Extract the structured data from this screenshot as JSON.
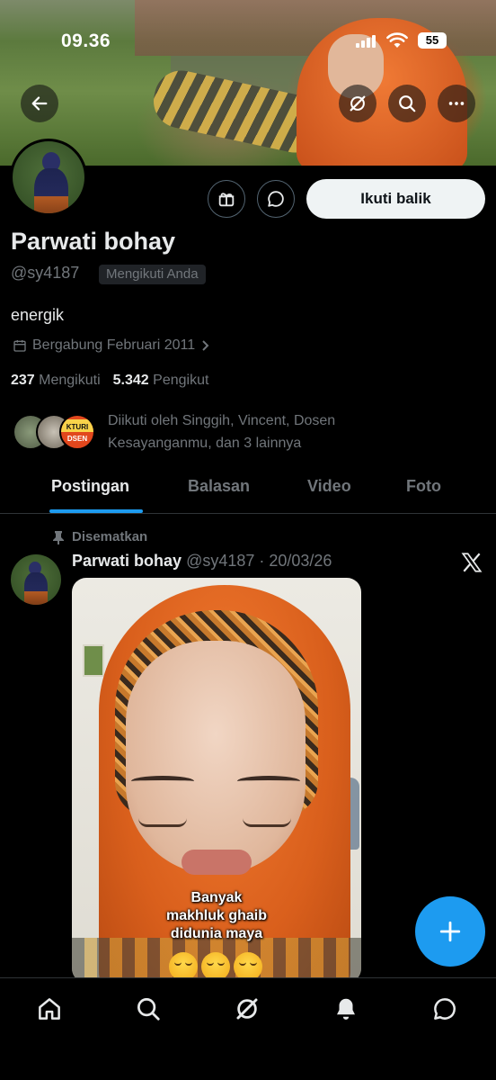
{
  "status_bar": {
    "time": "09.36",
    "battery": "55"
  },
  "profile": {
    "display_name": "Parwati bohay",
    "handle": "@sy4187",
    "follows_you_badge": "Mengikuti Anda",
    "bio": "energik",
    "joined": "Bergabung Februari 2011",
    "following_count": "237",
    "following_label": "Mengikuti",
    "followers_count": "5.342",
    "followers_label": "Pengikut",
    "followed_by": "Diikuti oleh Singgih, Vincent, Dosen Kesayanganmu, dan 3 lainnya",
    "follow_back_label": "Ikuti balik",
    "follower_avatar_text": "KTURI DSEN"
  },
  "tabs": [
    {
      "label": "Postingan",
      "active": true
    },
    {
      "label": "Balasan",
      "active": false
    },
    {
      "label": "Video",
      "active": false
    },
    {
      "label": "Foto",
      "active": false
    }
  ],
  "pinned_post": {
    "pinned_label": "Disematkan",
    "author": "Parwati bohay",
    "handle_date": "@sy4187 · 20/03/26",
    "caption_lines": [
      "Banyak",
      "makhluk ghaib",
      "didunia maya"
    ]
  },
  "icons": {
    "top": [
      "back-arrow-icon",
      "grok-icon",
      "search-icon",
      "more-icon"
    ],
    "actions": [
      "gift-icon",
      "message-icon"
    ],
    "nav": [
      "home-icon",
      "search-icon",
      "grok-icon",
      "notifications-icon",
      "messages-icon"
    ]
  },
  "colors": {
    "accent": "#1d9bf0",
    "background": "#000000",
    "text": "#e7e9ea",
    "muted": "#71767b"
  }
}
